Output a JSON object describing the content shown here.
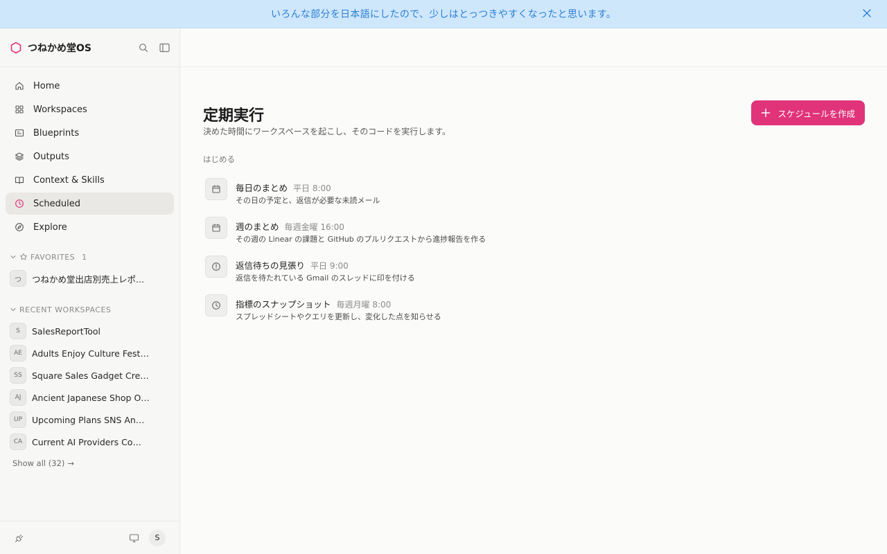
{
  "banner": {
    "text": "いろんな部分を日本語にしたので、少しはとっつきやすくなったと思います。"
  },
  "sidebar": {
    "app_title": "つねかめ堂OS",
    "nav": [
      {
        "label": "Home",
        "icon": "home-icon"
      },
      {
        "label": "Workspaces",
        "icon": "grid-icon"
      },
      {
        "label": "Blueprints",
        "icon": "blueprint-icon"
      },
      {
        "label": "Outputs",
        "icon": "layers-icon"
      },
      {
        "label": "Context & Skills",
        "icon": "book-icon"
      },
      {
        "label": "Scheduled",
        "icon": "clock-icon",
        "active": true
      },
      {
        "label": "Explore",
        "icon": "compass-icon"
      }
    ],
    "favorites": {
      "label": "FAVORITES",
      "count": "1",
      "items": [
        {
          "avatar": "つ",
          "label": "つねかめ堂出店別売上レポ..."
        }
      ]
    },
    "recent": {
      "label": "RECENT WORKSPACES",
      "items": [
        {
          "avatar": "S",
          "label": "SalesReportTool"
        },
        {
          "avatar": "AE",
          "label": "Adults Enjoy Culture Festival"
        },
        {
          "avatar": "SS",
          "label": "Square Sales Gadget Creation"
        },
        {
          "avatar": "AJ",
          "label": "Ancient Japanese Shop Origi..."
        },
        {
          "avatar": "UP",
          "label": "Upcoming Plans SNS Annou..."
        },
        {
          "avatar": "CA",
          "label": "Current AI Providers Compar..."
        }
      ],
      "show_all": "Show all (32)"
    },
    "footer": {
      "user_initial": "S"
    }
  },
  "main": {
    "title": "定期実行",
    "subtitle": "決めた時間にワークスペースを起こし、そのコードを実行します。",
    "create_button": "スケジュールを作成",
    "section_label": "はじめる",
    "schedules": [
      {
        "title": "毎日のまとめ",
        "when": "平日 8:00",
        "desc": "その日の予定と、返信が必要な未読メール",
        "icon": "calendar-icon"
      },
      {
        "title": "週のまとめ",
        "when": "毎週金曜 16:00",
        "desc": "その週の Linear の課題と GitHub のプルリクエストから進捗報告を作る",
        "icon": "calendar-icon"
      },
      {
        "title": "返信待ちの見張り",
        "when": "平日 9:00",
        "desc": "返信を待たれている Gmail のスレッドに印を付ける",
        "icon": "alert-circle-icon"
      },
      {
        "title": "指標のスナップショット",
        "when": "毎週月曜 8:00",
        "desc": "スプレッドシートやクエリを更新し、変化した点を知らせる",
        "icon": "clock-icon"
      }
    ]
  },
  "colors": {
    "accent": "#e0337a",
    "banner_bg": "#cfe7fb",
    "banner_text": "#2a7fd4"
  }
}
